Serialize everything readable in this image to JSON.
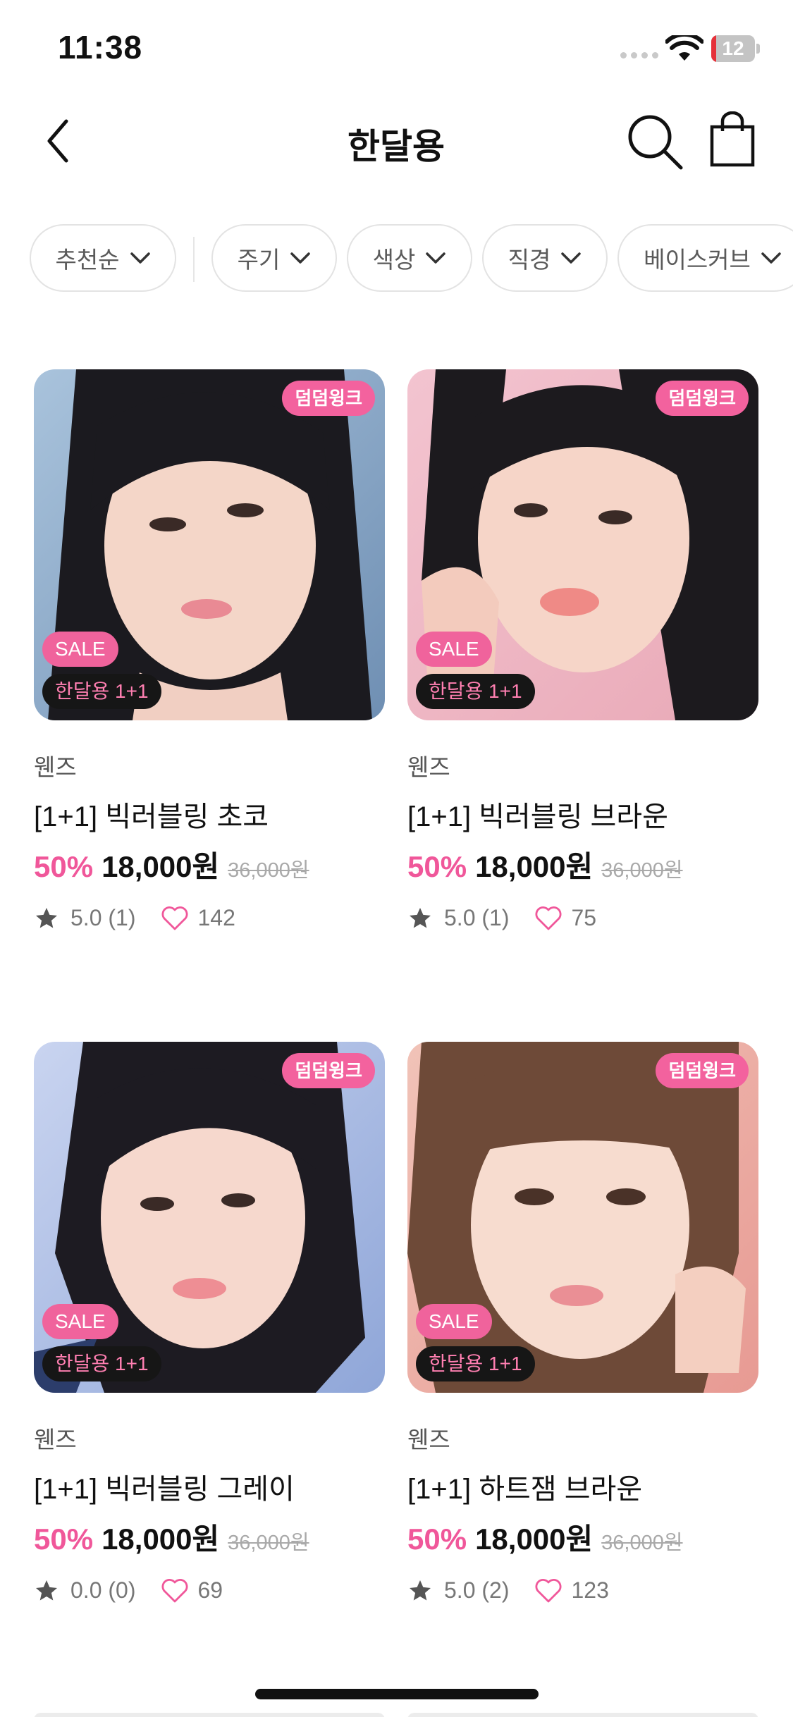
{
  "status_bar": {
    "time": "11:38",
    "battery": "12",
    "battery_level": 0.12,
    "battery_color": "#e5313a"
  },
  "header": {
    "title": "한달용",
    "back_icon": "chevron-left-icon",
    "search_icon": "search-icon",
    "cart_icon": "shopping-bag-icon"
  },
  "filters": [
    {
      "label": "추천순"
    },
    {
      "label": "주기"
    },
    {
      "label": "색상"
    },
    {
      "label": "직경"
    },
    {
      "label": "베이스커브"
    }
  ],
  "colors": {
    "accent": "#f0579a",
    "badge_pink": "#f3629e",
    "badge_dark": "#161616"
  },
  "products": [
    {
      "badge": "덤덤윙크",
      "sale": "SALE",
      "promo": "한달용 1+1",
      "brand": "웬즈",
      "name": "[1+1] 빅러블링 초코",
      "discount": "50%",
      "price": "18,000원",
      "original_price": "36,000원",
      "rating": "5.0 (1)",
      "likes": "142",
      "rating_value": 5.0
    },
    {
      "badge": "덤덤윙크",
      "sale": "SALE",
      "promo": "한달용 1+1",
      "brand": "웬즈",
      "name": "[1+1] 빅러블링 브라운",
      "discount": "50%",
      "price": "18,000원",
      "original_price": "36,000원",
      "rating": "5.0 (1)",
      "likes": "75",
      "rating_value": 5.0
    },
    {
      "badge": "덤덤윙크",
      "sale": "SALE",
      "promo": "한달용 1+1",
      "brand": "웬즈",
      "name": "[1+1] 빅러블링 그레이",
      "discount": "50%",
      "price": "18,000원",
      "original_price": "36,000원",
      "rating": "0.0 (0)",
      "likes": "69",
      "rating_value": 0.0
    },
    {
      "badge": "덤덤윙크",
      "sale": "SALE",
      "promo": "한달용 1+1",
      "brand": "웬즈",
      "name": "[1+1] 하트잼 브라운",
      "discount": "50%",
      "price": "18,000원",
      "original_price": "36,000원",
      "rating": "5.0 (2)",
      "likes": "123",
      "rating_value": 5.0
    }
  ]
}
